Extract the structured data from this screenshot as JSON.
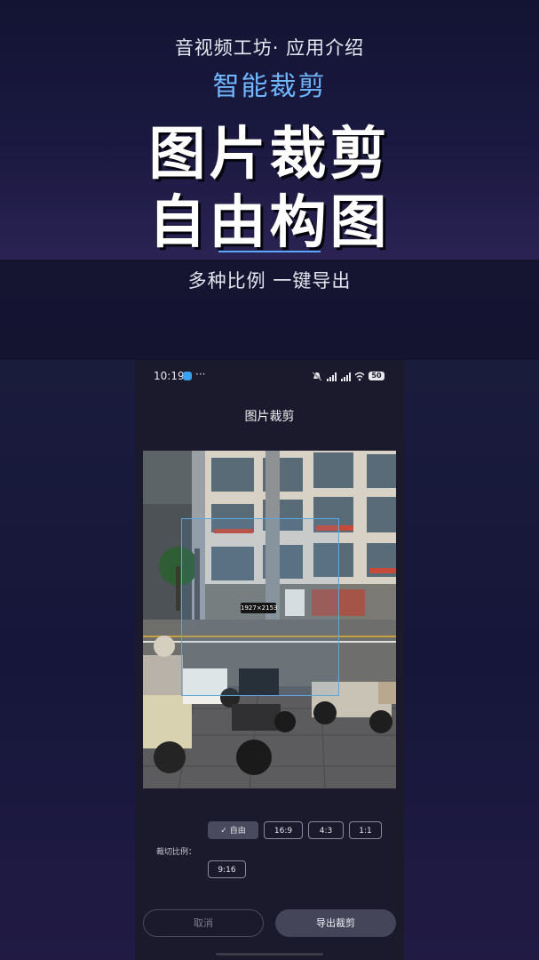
{
  "promo": {
    "subtitle": "音视频工坊· 应用介绍",
    "feature": "智能裁剪",
    "headline_line1": "图片裁剪",
    "headline_line2": "自由构图",
    "tagline": "多种比例 一键导出"
  },
  "status_bar": {
    "time": "10:19",
    "more": "···",
    "battery": "50",
    "icons": [
      "app-icon",
      "mute-bell-icon",
      "signal-5g-icon",
      "signal-5g-icon",
      "wifi-icon",
      "battery-icon"
    ]
  },
  "app": {
    "title": "图片裁剪",
    "crop_dimensions": "1927×2153",
    "ratio_label": "裁切比例：",
    "ratios": [
      {
        "label": "自由",
        "selected": true
      },
      {
        "label": "16:9",
        "selected": false
      },
      {
        "label": "4:3",
        "selected": false
      },
      {
        "label": "1:1",
        "selected": false
      },
      {
        "label": "9:16",
        "selected": false
      }
    ],
    "check_mark": "✓",
    "cancel": "取消",
    "export": "导出裁剪"
  },
  "colors": {
    "accent": "#6fb7ff",
    "crop_border": "#5aa8e0",
    "button_active": "#4a4a5e"
  }
}
